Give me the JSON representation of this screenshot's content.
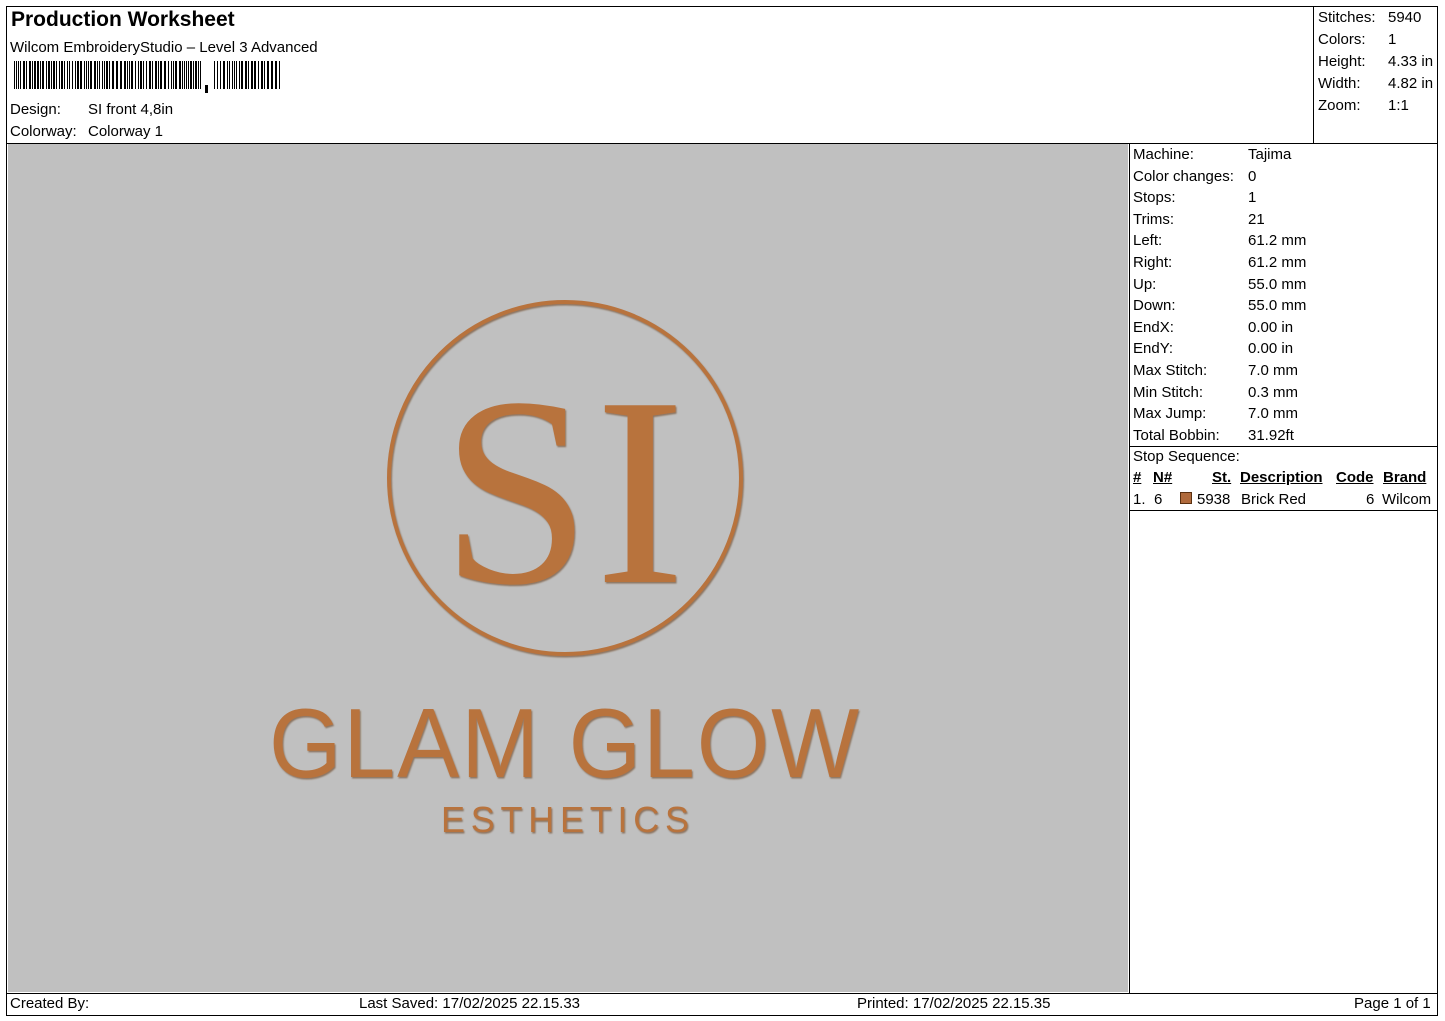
{
  "header": {
    "title": "Production Worksheet",
    "subtitle": "Wilcom EmbroideryStudio – Level 3 Advanced",
    "design_label": "Design:",
    "design_value": "SI front 4,8in",
    "colorway_label": "Colorway:",
    "colorway_value": "Colorway 1"
  },
  "stats": [
    {
      "label": "Stitches:",
      "value": "5940"
    },
    {
      "label": "Colors:",
      "value": "1"
    },
    {
      "label": "Height:",
      "value": "4.33 in"
    },
    {
      "label": "Width:",
      "value": "4.82 in"
    },
    {
      "label": "Zoom:",
      "value": "1:1"
    }
  ],
  "design_preview": {
    "monogram": "SI",
    "line1": "GLAM GLOW",
    "line2": "ESTHETICS",
    "thread_color": "#b8733e",
    "background_color": "#c0c0c0"
  },
  "machine_info": [
    {
      "label": "Machine:",
      "value": "Tajima"
    },
    {
      "label": "Color changes:",
      "value": "0"
    },
    {
      "label": "Stops:",
      "value": "1"
    },
    {
      "label": "Trims:",
      "value": "21"
    },
    {
      "label": "Left:",
      "value": "61.2 mm"
    },
    {
      "label": "Right:",
      "value": "61.2 mm"
    },
    {
      "label": "Up:",
      "value": "55.0 mm"
    },
    {
      "label": "Down:",
      "value": "55.0 mm"
    },
    {
      "label": "EndX:",
      "value": "0.00 in"
    },
    {
      "label": "EndY:",
      "value": "0.00 in"
    },
    {
      "label": "Max Stitch:",
      "value": "7.0 mm"
    },
    {
      "label": "Min Stitch:",
      "value": "0.3 mm"
    },
    {
      "label": "Max Jump:",
      "value": "7.0 mm"
    },
    {
      "label": "Total Bobbin:",
      "value": "31.92ft"
    }
  ],
  "stop_sequence": {
    "title": "Stop Sequence:",
    "headers": {
      "num": "#",
      "n": "N#",
      "st": "St.",
      "description": "Description",
      "code": "Code",
      "brand": "Brand"
    },
    "rows": [
      {
        "num": "1.",
        "n": "6",
        "swatch_color": "#b06a3c",
        "st": "5938",
        "description": "Brick Red",
        "code": "6",
        "brand": "Wilcom"
      }
    ]
  },
  "footer": {
    "created_by": "Created By:",
    "last_saved": "Last Saved: 17/02/2025 22.15.33",
    "printed": "Printed: 17/02/2025 22.15.35",
    "page": "Page 1 of 1"
  }
}
